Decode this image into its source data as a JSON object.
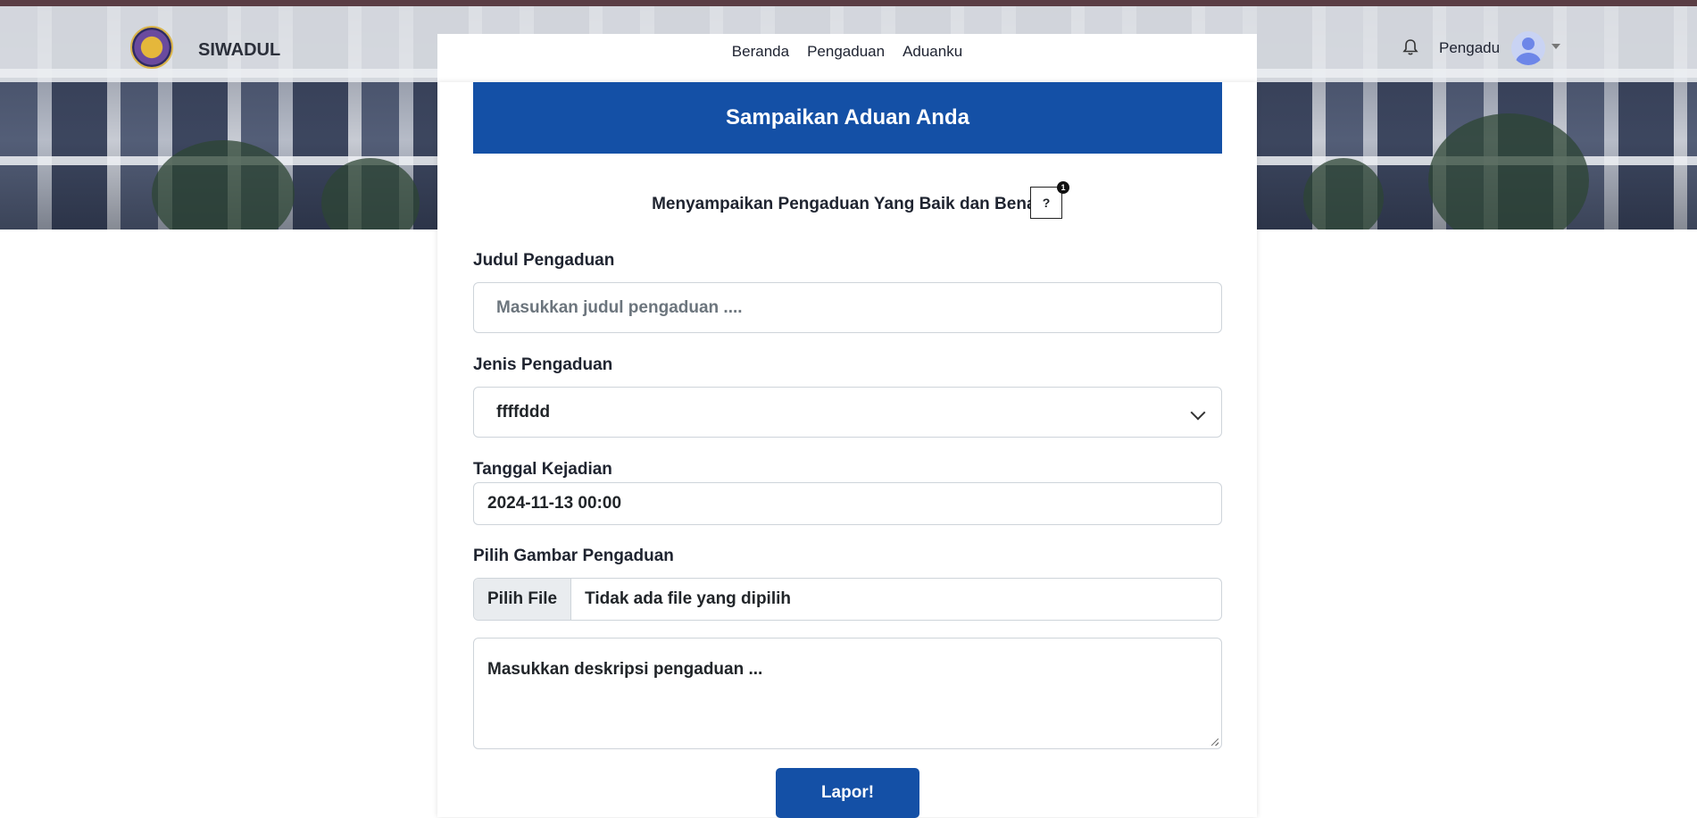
{
  "app": {
    "brand": "SIWADUL"
  },
  "nav": {
    "links": [
      "Beranda",
      "Pengaduan",
      "Aduanku"
    ]
  },
  "user": {
    "name": "Pengadu"
  },
  "icons": {
    "logo": "institution-logo",
    "bell": "bell-icon",
    "avatar": "user-avatar-icon",
    "caret": "caret-down-icon",
    "help": "help-icon"
  },
  "form": {
    "header": "Sampaikan Aduan Anda",
    "subtitle": "Menyampaikan Pengaduan Yang Baik dan Benar",
    "help_label": "?",
    "help_badge": "1",
    "title_label": "Judul Pengaduan",
    "title_placeholder": "Masukkan judul pengaduan ....",
    "type_label": "Jenis Pengaduan",
    "type_value": "ffffddd",
    "date_label": "Tanggal Kejadian",
    "date_value": "2024-11-13 00:00",
    "image_label": "Pilih Gambar Pengaduan",
    "file_button": "Pilih File",
    "file_status": "Tidak ada file yang dipilih",
    "description_placeholder": "Masukkan deskripsi pengaduan ...",
    "submit_label": "Lapor!"
  },
  "colors": {
    "primary": "#1450a6",
    "top_strip": "#5a3d44"
  }
}
